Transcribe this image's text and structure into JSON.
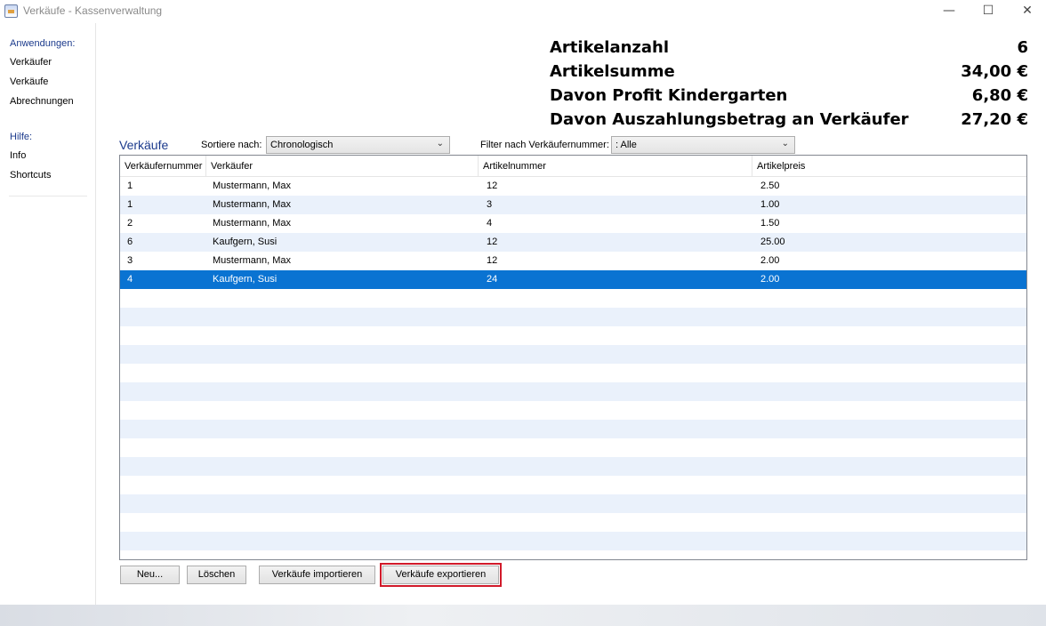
{
  "window": {
    "title": "Verkäufe - Kassenverwaltung",
    "controls": {
      "minimize": "—",
      "maximize": "☐",
      "close": "✕"
    }
  },
  "sidebar": {
    "apps_heading": "Anwendungen:",
    "apps": [
      "Verkäufer",
      "Verkäufe",
      "Abrechnungen"
    ],
    "help_heading": "Hilfe:",
    "help": [
      "Info",
      "Shortcuts"
    ]
  },
  "summary": [
    {
      "label": "Artikelanzahl",
      "value": "6"
    },
    {
      "label": "Artikelsumme",
      "value": "34,00 €"
    },
    {
      "label": "Davon Profit Kindergarten",
      "value": "6,80 €"
    },
    {
      "label": "Davon Auszahlungsbetrag an Verkäufer",
      "value": "27,20 €"
    }
  ],
  "sales": {
    "title": "Verkäufe",
    "sort_label": "Sortiere nach:",
    "sort_value": "Chronologisch",
    "filter_label": "Filter nach Verkäufernummer:",
    "filter_value": ": Alle"
  },
  "table": {
    "columns": [
      "Verkäufernummer",
      "Verkäufer",
      "Artikelnummer",
      "Artikelpreis"
    ],
    "rows": [
      [
        "1",
        "Mustermann, Max",
        "12",
        "2.50"
      ],
      [
        "1",
        "Mustermann, Max",
        "3",
        "1.00"
      ],
      [
        "2",
        "Mustermann, Max",
        "4",
        "1.50"
      ],
      [
        "6",
        "Kaufgern, Susi",
        "12",
        "25.00"
      ],
      [
        "3",
        "Mustermann, Max",
        "12",
        "2.00"
      ],
      [
        "4",
        "Kaufgern, Susi",
        "24",
        "2.00"
      ]
    ],
    "selected_row": 5
  },
  "buttons": {
    "new": "Neu...",
    "delete": "Löschen",
    "import": "Verkäufe importieren",
    "export": "Verkäufe exportieren"
  },
  "colors": {
    "selection": "#0a73d2",
    "alt_row": "#eaf1fb",
    "heading_blue": "#1b3a8c",
    "highlight_red": "#d11a2a"
  }
}
